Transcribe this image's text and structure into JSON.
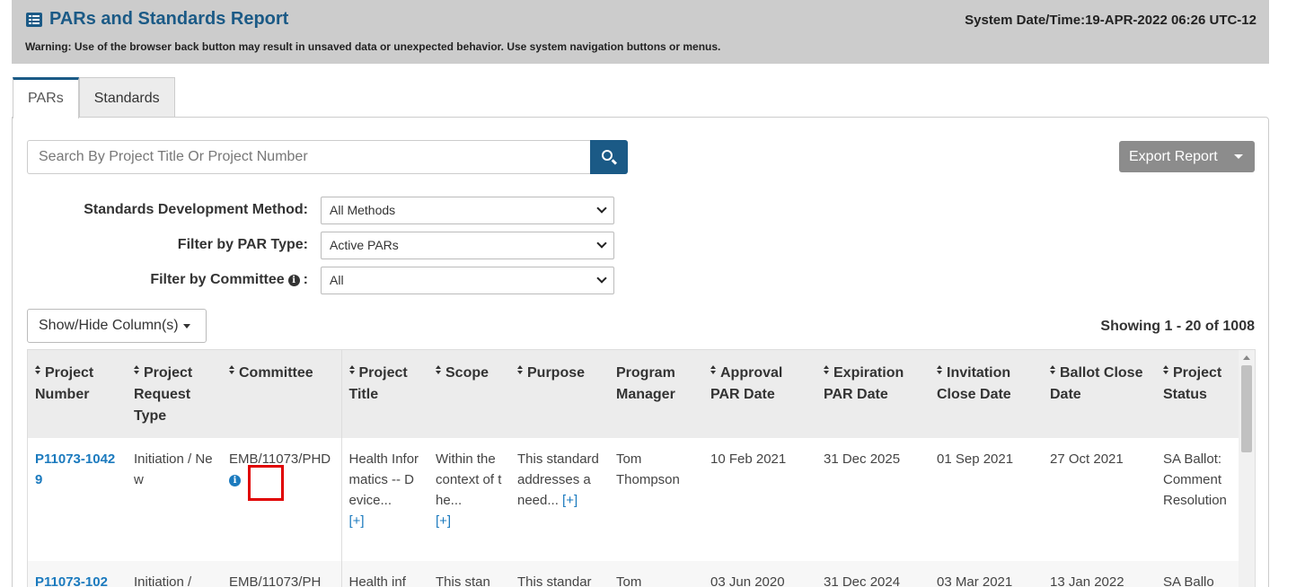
{
  "header": {
    "title": "PARs and Standards Report",
    "system_datetime": "System Date/Time:19-APR-2022 06:26 UTC-12",
    "warning": "Warning: Use of the browser back button may result in unsaved data or unexpected behavior. Use system navigation buttons or menus."
  },
  "tabs": [
    {
      "label": "PARs",
      "active": true
    },
    {
      "label": "Standards",
      "active": false
    }
  ],
  "search": {
    "placeholder": "Search By Project Title Or Project Number",
    "value": ""
  },
  "export": {
    "label": "Export Report"
  },
  "filters": {
    "method": {
      "label": "Standards Development Method:",
      "value": "All Methods"
    },
    "par_type": {
      "label": "Filter by PAR Type:",
      "value": "Active PARs"
    },
    "committee": {
      "label": "Filter by Committee",
      "suffix": ":",
      "value": "All"
    }
  },
  "columns_button": {
    "label": "Show/Hide Column(s)"
  },
  "showing": "Showing 1 - 20 of 1008",
  "table": {
    "headers": {
      "project_number": "Project Number",
      "request_type": "Project Request Type",
      "committee": "Committee",
      "title": "Project Title",
      "scope": "Scope",
      "purpose": "Purpose",
      "manager": "Program Manager",
      "approval": "Approval PAR Date",
      "expiration": "Expiration PAR Date",
      "invitation": "Invitation Close Date",
      "ballot": "Ballot Close Date",
      "status": "Project Status"
    },
    "more_label": "[+]",
    "rows": [
      {
        "project_number": "P11073-10429",
        "request_type": "Initiation / New",
        "committee": "EMB/11073/PHD",
        "title": "Health Informatics -- Device...",
        "scope": "Within the context of the...",
        "purpose": "This standard addresses a need...",
        "manager": "Tom Thompson",
        "approval": "10 Feb 2021",
        "expiration": "31 Dec 2025",
        "invitation": "01 Sep 2021",
        "ballot": "27 Oct 2021",
        "status": "SA Ballot: Comment Resolution"
      },
      {
        "project_number": "P11073-102",
        "request_type": "Initiation /",
        "committee": "EMB/11073/PH",
        "title": "Health inf",
        "scope": "This stan",
        "purpose": "This standar",
        "manager": "Tom",
        "approval": "03 Jun 2020",
        "expiration": "31 Dec 2024",
        "invitation": "03 Mar 2021",
        "ballot": "13 Jan 2022",
        "status": "SA Ballo"
      }
    ]
  }
}
